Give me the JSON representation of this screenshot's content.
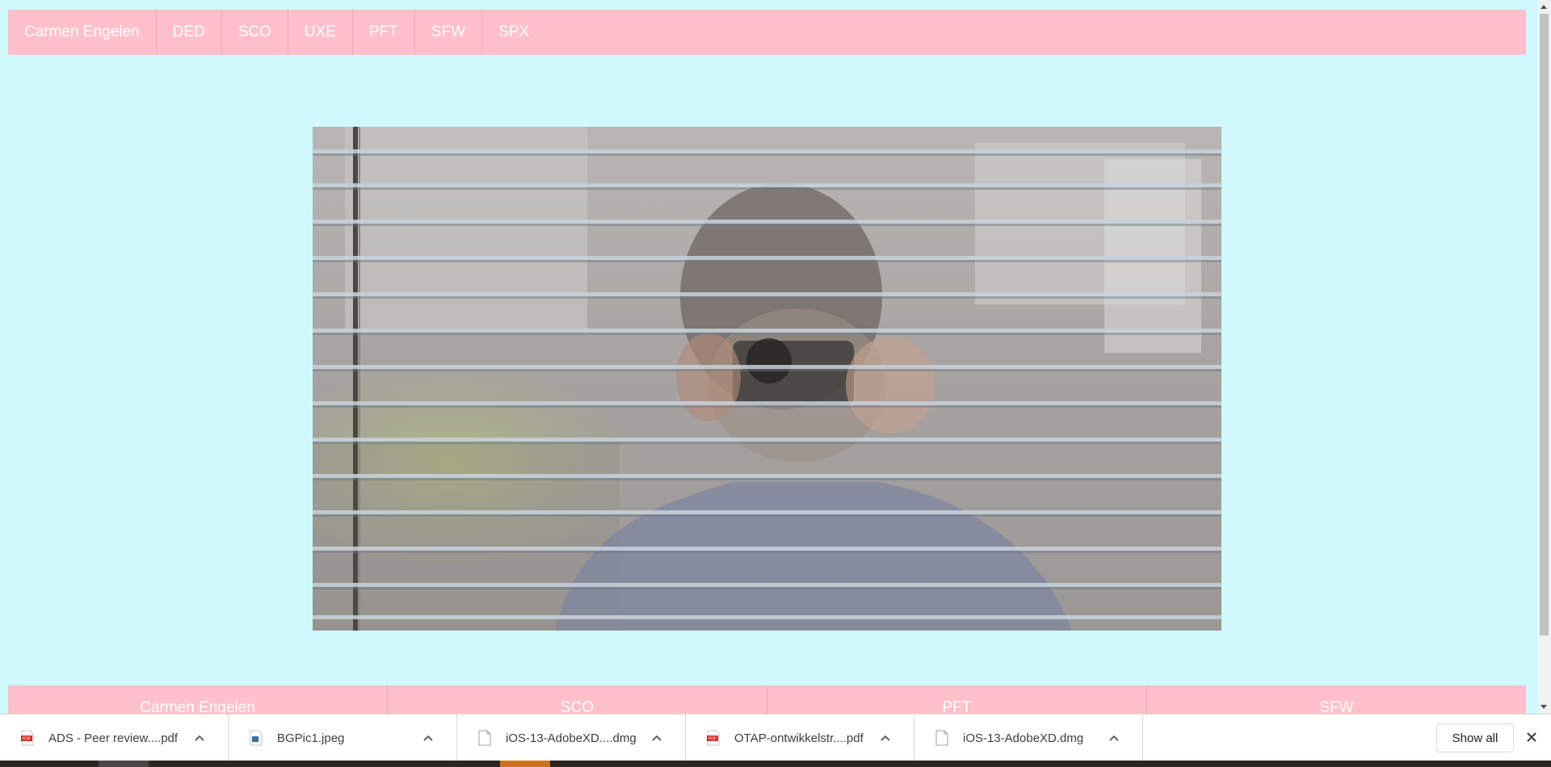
{
  "top_nav": {
    "brand": "Carmen Engelen",
    "items": [
      "DED",
      "SCO",
      "UXE",
      "PFT",
      "SFW",
      "SPX"
    ]
  },
  "bottom_nav": {
    "items": [
      "Carmen Engelen",
      "SCO",
      "PFT",
      "SFW"
    ]
  },
  "downloads": {
    "items": [
      {
        "name": "ADS - Peer review....pdf",
        "icon": "pdf-file-icon"
      },
      {
        "name": "BGPic1.jpeg",
        "icon": "image-file-icon"
      },
      {
        "name": "iOS-13-AdobeXD....dmg",
        "icon": "generic-file-icon"
      },
      {
        "name": "OTAP-ontwikkelstr....pdf",
        "icon": "pdf-file-icon"
      },
      {
        "name": "iOS-13-AdobeXD.dmg",
        "icon": "generic-file-icon"
      }
    ],
    "show_all_label": "Show all"
  },
  "colors": {
    "page_background": "#cff9fd",
    "nav_background": "#ffc0cb",
    "nav_text": "#ffffff"
  }
}
